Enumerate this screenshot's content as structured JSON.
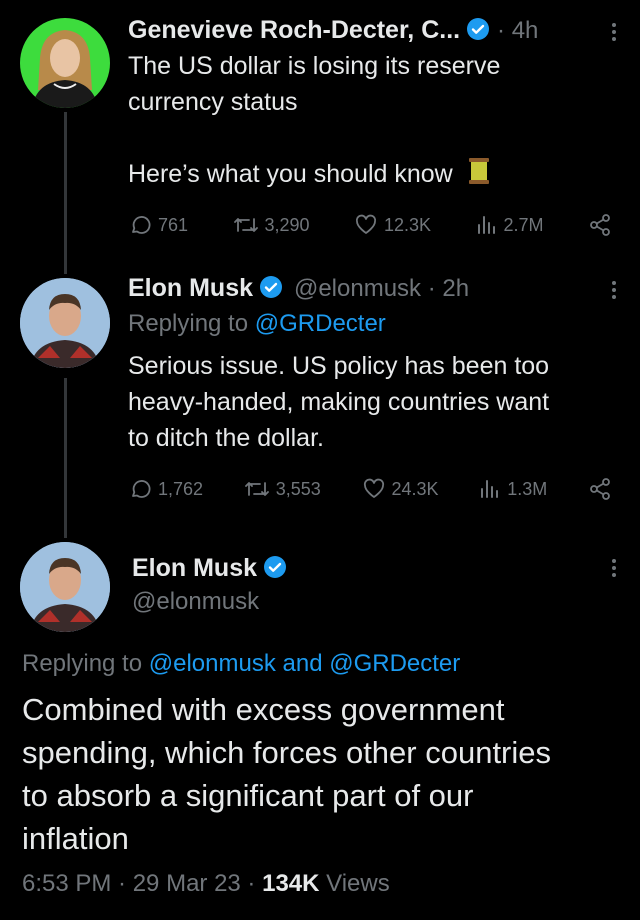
{
  "tweets": [
    {
      "name": "Genevieve Roch-Decter, C...",
      "meta": "· 4h",
      "text_lines": [
        "The US dollar is losing its reserve",
        "currency status",
        "",
        "Here’s what you should know"
      ],
      "thread_emoji": "🧵",
      "stats": {
        "replies": "761",
        "retweets": "3,290",
        "likes": "12.3K",
        "views": "2.7M"
      }
    },
    {
      "name": "Elon Musk",
      "handle_meta": "@elonmusk · 2h",
      "replying_prefix": "Replying to ",
      "replying_to": "@GRDecter",
      "text_lines": [
        "Serious issue. US policy has been too",
        "heavy-handed, making countries want",
        "to ditch the dollar."
      ],
      "stats": {
        "replies": "1,762",
        "retweets": "3,553",
        "likes": "24.3K",
        "views": "1.3M"
      }
    }
  ],
  "main": {
    "name": "Elon Musk",
    "handle": "@elonmusk",
    "replying_prefix": "Replying to ",
    "replying_to": "@elonmusk and @GRDecter",
    "text_lines": [
      "Combined with excess government",
      "spending, which forces other countries",
      "to absorb a significant part of our",
      "inflation"
    ],
    "time": "6:53 PM · 29 Mar 23 · ",
    "views_count": "134K",
    "views_label": " Views"
  },
  "colors": {
    "background": "#000000",
    "text": "#e7e9ea",
    "secondary": "#71767b",
    "accent": "#1d9bf0",
    "avatar_green": "#3ddc3d"
  }
}
